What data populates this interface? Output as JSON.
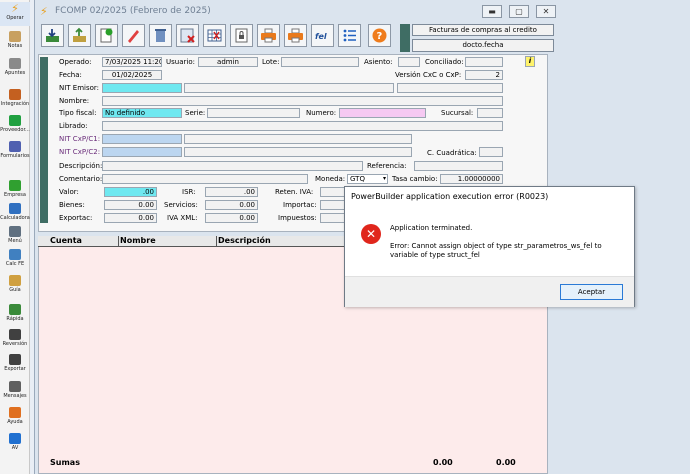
{
  "sidebar": {
    "items": [
      {
        "label": "Operar",
        "icon": "lightning-icon",
        "color": "#e8a020"
      },
      {
        "label": "Notas",
        "icon": "note-icon",
        "color": "#c8a060"
      },
      {
        "label": "Apuntes",
        "icon": "notebook-icon",
        "color": "#8a8a8a"
      },
      {
        "label": "Integración",
        "icon": "integration-icon",
        "color": "#c46020"
      },
      {
        "label": "Proveedor...",
        "icon": "supplier-icon",
        "color": "#20a040"
      },
      {
        "label": "Formularios",
        "icon": "forms-icon",
        "color": "#5060b0"
      },
      {
        "label": "Empresa",
        "icon": "company-icon",
        "color": "#30a030"
      },
      {
        "label": "Calculadora",
        "icon": "calculator-icon",
        "color": "#3070c0"
      },
      {
        "label": "Menú",
        "icon": "menu-icon",
        "color": "#607080"
      },
      {
        "label": "Calc FE",
        "icon": "calc-fe-icon",
        "color": "#4080c0"
      },
      {
        "label": "Guía",
        "icon": "guide-icon",
        "color": "#d0a040"
      },
      {
        "label": "Rápida",
        "icon": "quick-icon",
        "color": "#3a8a3a"
      },
      {
        "label": "Reversión",
        "icon": "binoculars-icon",
        "color": "#404040"
      },
      {
        "label": "Exportar",
        "icon": "export-icon",
        "color": "#404040"
      },
      {
        "label": "Mensajes",
        "icon": "messages-icon",
        "color": "#606060"
      },
      {
        "label": "Ayuda",
        "icon": "help-icon",
        "color": "#e07020"
      },
      {
        "label": "AV",
        "icon": "av-icon",
        "color": "#2070d0"
      }
    ]
  },
  "window": {
    "title": "FCOMP 02/2025 (Febrero de 2025)",
    "info_line1": "Facturas de compras al credito",
    "info_line2": "docto.fecha"
  },
  "form": {
    "operado_label": "Operado:",
    "operado_value": "7/03/2025 11:20",
    "usuario_label": "Usuario:",
    "usuario_value": "admin",
    "lote_label": "Lote:",
    "lote_value": "",
    "asiento_label": "Asiento:",
    "asiento_value": "",
    "conciliado_label": "Conciliado:",
    "conciliado_value": "",
    "fecha_label": "Fecha:",
    "fecha_value": "01/02/2025",
    "version_label": "Versión CxC o CxP:",
    "version_value": "2",
    "nit_emisor_label": "NIT Emisor:",
    "nit_emisor_value": "",
    "nombre_label": "Nombre:",
    "nombre_value": "",
    "tipo_fiscal_label": "Tipo fiscal:",
    "tipo_fiscal_value": "No definido",
    "serie_label": "Serie:",
    "serie_value": "",
    "numero_label": "Numero:",
    "numero_value": "",
    "sucursal_label": "Sucursal:",
    "sucursal_value": "",
    "librado_label": "Librado:",
    "librado_value": "",
    "nit_c1_label": "NIT CxP/C1:",
    "nit_c1_value": "",
    "nit_c2_label": "NIT CxP/C2:",
    "nit_c2_value": "",
    "c_cuadratica_label": "C. Cuadrática:",
    "c_cuadratica_value": "",
    "descripcion_label": "Descripción:",
    "descripcion_value": "",
    "referencia_label": "Referencia:",
    "referencia_value": "",
    "comentario_label": "Comentario:",
    "comentario_value": "",
    "moneda_label": "Moneda:",
    "moneda_value": "GTQ",
    "tasa_label": "Tasa cambio:",
    "tasa_value": "1.00000000",
    "valor_label": "Valor:",
    "valor_value": ".00",
    "isr_label": "ISR:",
    "isr_value": ".00",
    "reten_iva_label": "Reten. IVA:",
    "bienes_label": "Bienes:",
    "bienes_value": "0.00",
    "servicios_label": "Servicios:",
    "servicios_value": "0.00",
    "importac_label": "Importac:",
    "exportac_label": "Exportac:",
    "exportac_value": "0.00",
    "iva_xml_label": "IVA XML:",
    "iva_xml_value": "0.00",
    "impuestos_label": "Impuestos:",
    "info_marker": "i"
  },
  "grid": {
    "columns": [
      "Cuenta",
      "Nombre",
      "Descripción"
    ],
    "sumas_label": "Sumas",
    "sum1": "0.00",
    "sum2": "0.00"
  },
  "dialog": {
    "title": "PowerBuilder application execution error (R0023)",
    "message1": "Application terminated.",
    "message2": "Error: Cannot assign object of type str_parametros_ws_fel to variable of type struct_fel",
    "ok_label": "Aceptar"
  }
}
